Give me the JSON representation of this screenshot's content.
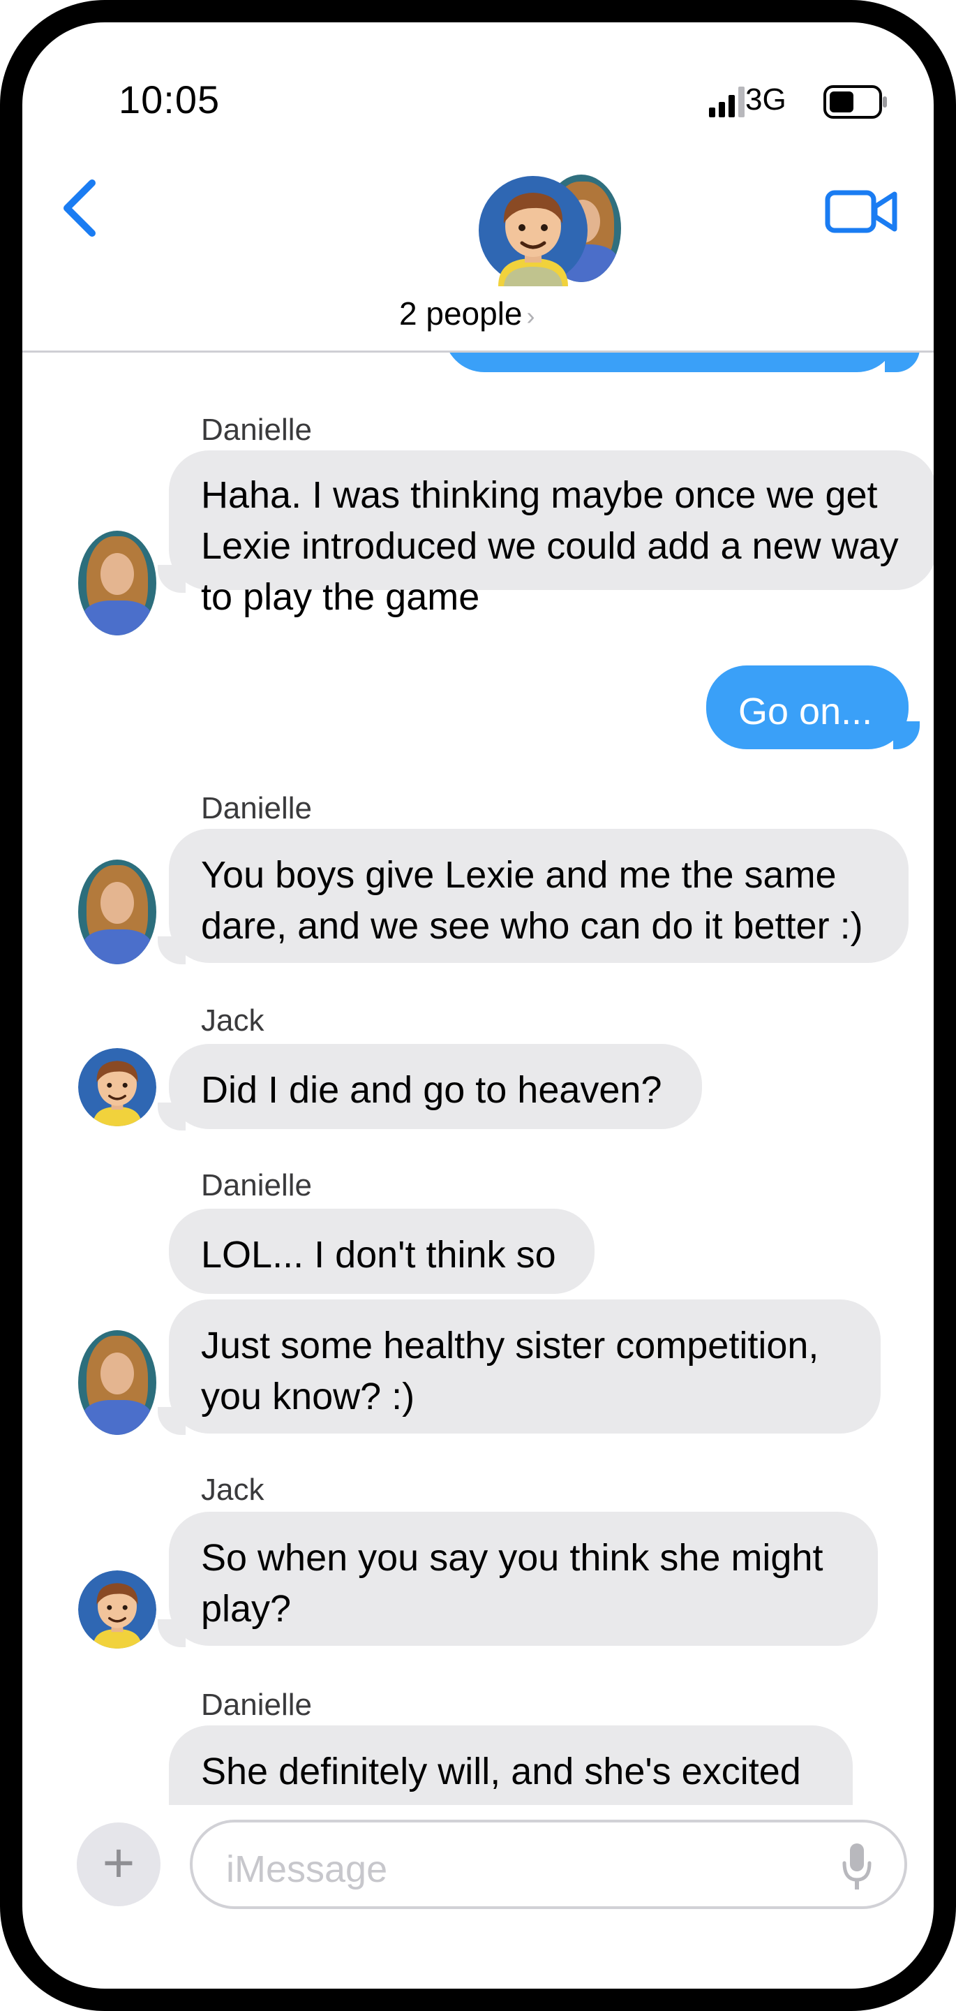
{
  "status_bar": {
    "time": "10:05",
    "network": "3G"
  },
  "header": {
    "title": "2 people",
    "chevron": "›"
  },
  "icons": {
    "back": "chevron-left-icon",
    "video": "video-camera-icon",
    "plus": "plus-icon",
    "mic": "microphone-icon"
  },
  "colors": {
    "accent": "#1a7cf2",
    "outgoing_bubble": "#3aa0f8",
    "incoming_bubble": "#e9e9eb"
  },
  "messages": [
    {
      "sender": "Danielle",
      "text": "Haha.  I was thinking maybe once we get Lexie introduced we could add a new way to play the game"
    },
    {
      "sender": "me",
      "text": "Go on..."
    },
    {
      "sender": "Danielle",
      "text": "You boys give Lexie and me the same dare, and we see who can do it better :)"
    },
    {
      "sender": "Jack",
      "text": "Did I die and go to heaven?"
    },
    {
      "sender": "Danielle",
      "text": "LOL... I don't think so"
    },
    {
      "sender": "Danielle",
      "text": "Just some healthy sister competition, you know? :)"
    },
    {
      "sender": "Jack",
      "text": "So when you say you think she might play?"
    },
    {
      "sender": "Danielle",
      "text": "She definitely will, and she's excited"
    }
  ],
  "input": {
    "plus": "+",
    "placeholder": "iMessage"
  }
}
